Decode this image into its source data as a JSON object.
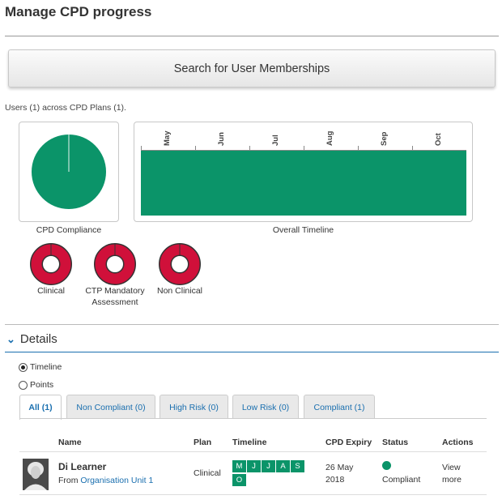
{
  "page": {
    "title": "Manage CPD progress"
  },
  "search": {
    "label": "Search for User Memberships"
  },
  "summary": {
    "text": "Users (1) across CPD Plans (1)."
  },
  "charts": {
    "compliance": {
      "caption": "CPD Compliance",
      "color": "#0b9469",
      "compliant_fraction": 1.0
    },
    "timeline": {
      "caption": "Overall Timeline",
      "months": [
        "May",
        "Jun",
        "Jul",
        "Aug",
        "Sep",
        "Oct"
      ],
      "color": "#0b9469"
    },
    "donuts": [
      {
        "label": "Clinical",
        "color": "#d0103a"
      },
      {
        "label": "CTP Mandatory Assessment",
        "label_line1": "CTP Mandatory",
        "label_line2": "Assessment",
        "color": "#d0103a"
      },
      {
        "label": "Non Clinical",
        "color": "#d0103a"
      }
    ]
  },
  "details": {
    "title": "Details",
    "views": [
      {
        "label": "Timeline",
        "selected": true
      },
      {
        "label": "Points",
        "selected": false
      }
    ],
    "tabs": [
      {
        "label": "All (1)",
        "active": true
      },
      {
        "label": "Non Compliant (0)",
        "active": false
      },
      {
        "label": "High Risk (0)",
        "active": false
      },
      {
        "label": "Low Risk (0)",
        "active": false
      },
      {
        "label": "Compliant (1)",
        "active": false
      }
    ],
    "table": {
      "headers": {
        "name": "Name",
        "plan": "Plan",
        "timeline": "Timeline",
        "expiry": "CPD Expiry",
        "status": "Status",
        "actions": "Actions"
      },
      "rows": [
        {
          "name": "Di Learner",
          "from_prefix": "From",
          "org": "Organisation Unit 1",
          "plan": "Clinical",
          "timeline_months": [
            "M",
            "J",
            "J",
            "A",
            "S",
            "O"
          ],
          "expiry_line1": "26 May",
          "expiry_line2": "2018",
          "status": "Compliant",
          "status_color": "#0b9469",
          "action_line1": "View",
          "action_line2": "more"
        }
      ]
    }
  }
}
